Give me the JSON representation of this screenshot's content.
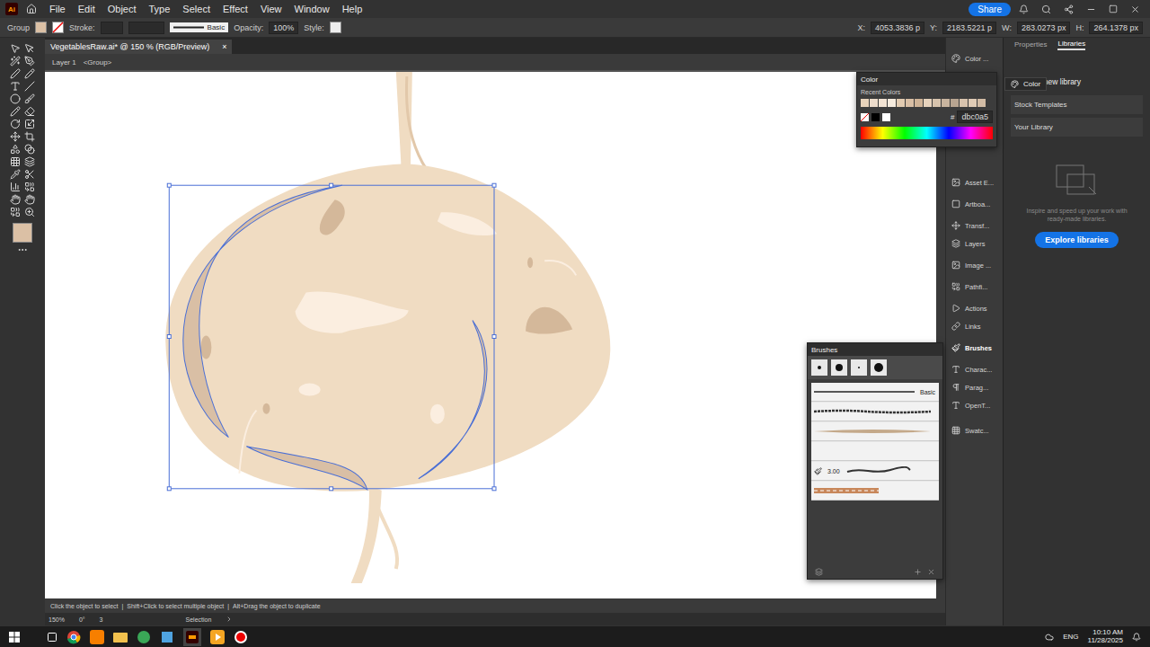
{
  "app": {
    "logo": "Ai"
  },
  "menu": [
    "File",
    "Edit",
    "Object",
    "Type",
    "Select",
    "Effect",
    "View",
    "Window",
    "Help"
  ],
  "share": "Share",
  "control_bar": {
    "selection": "Group",
    "stroke_label": "Stroke:",
    "brush": "Basic",
    "opacity_label": "Opacity:",
    "opacity": "100%",
    "style_label": "Style:",
    "x_label": "X:",
    "x": "4053.3836 p",
    "y_label": "Y:",
    "y": "2183.5221 p",
    "w_label": "W:",
    "w": "283.0273 px",
    "h_label": "H:",
    "h": "264.1378 px"
  },
  "document_tab": {
    "title": "VegetablesRaw.ai* @ 150 % (RGB/Preview)",
    "close": "×"
  },
  "breadcrumb": [
    "Layer 1",
    "<Group>"
  ],
  "hint": [
    "Click the object to select",
    "Shift+Click to select multiple object",
    "Alt+Drag the object to duplicate"
  ],
  "status_bar": {
    "zoom": "150%",
    "rotation": "0°",
    "artboard": "3",
    "tool": "Selection"
  },
  "dock": [
    {
      "label": "Color ...",
      "selected": false
    },
    {
      "label": "Asset E...",
      "selected": false
    },
    {
      "label": "Artboa...",
      "selected": false
    },
    {
      "label": "Transf...",
      "selected": false
    },
    {
      "label": "Layers",
      "selected": false
    },
    {
      "label": "Image ...",
      "selected": false
    },
    {
      "label": "Pathfi...",
      "selected": false
    },
    {
      "label": "Actions",
      "selected": false
    },
    {
      "label": "Links",
      "selected": false
    },
    {
      "label": "Brushes",
      "selected": true
    },
    {
      "label": "Charac...",
      "selected": false
    },
    {
      "label": "Parag...",
      "selected": false
    },
    {
      "label": "OpenT...",
      "selected": false
    },
    {
      "label": "Swatc...",
      "selected": false
    }
  ],
  "color_panel": {
    "title": "Color",
    "recent_label": "Recent Colors",
    "recent": [
      "#e8d3bb",
      "#eddccb",
      "#f2e3d3",
      "#f6ebde",
      "#e2cbb1",
      "#d9bfa5",
      "#cfb397",
      "#e6d2bc",
      "#d7c3ad",
      "#c8b49e",
      "#b8a591",
      "#d9c4ae",
      "#e0ccb6",
      "#d2bca5"
    ],
    "hash": "#",
    "hex": "dbc0a5"
  },
  "brushes_panel": {
    "title": "Brushes",
    "brushes": [
      {
        "kind": "line",
        "label": "Basic"
      },
      {
        "kind": "charcoal",
        "label": ""
      },
      {
        "kind": "taper",
        "label": ""
      },
      {
        "kind": "blank",
        "label": ""
      },
      {
        "kind": "size",
        "label": "3.00"
      },
      {
        "kind": "pattern",
        "label": ""
      }
    ]
  },
  "libraries": {
    "tabs": [
      {
        "label": "Properties",
        "selected": false
      },
      {
        "label": "Libraries",
        "selected": true
      }
    ],
    "tooltip": "Color",
    "create_icon": "+",
    "create": "Create new library",
    "items": [
      "Stock Templates",
      "Your Library"
    ],
    "empty_text": "Inspire and speed up your work with ready-made libraries.",
    "button": "Explore libraries"
  },
  "taskbar": {
    "language": "ENG",
    "time": "10:10 AM",
    "date": "11/28/2025"
  }
}
